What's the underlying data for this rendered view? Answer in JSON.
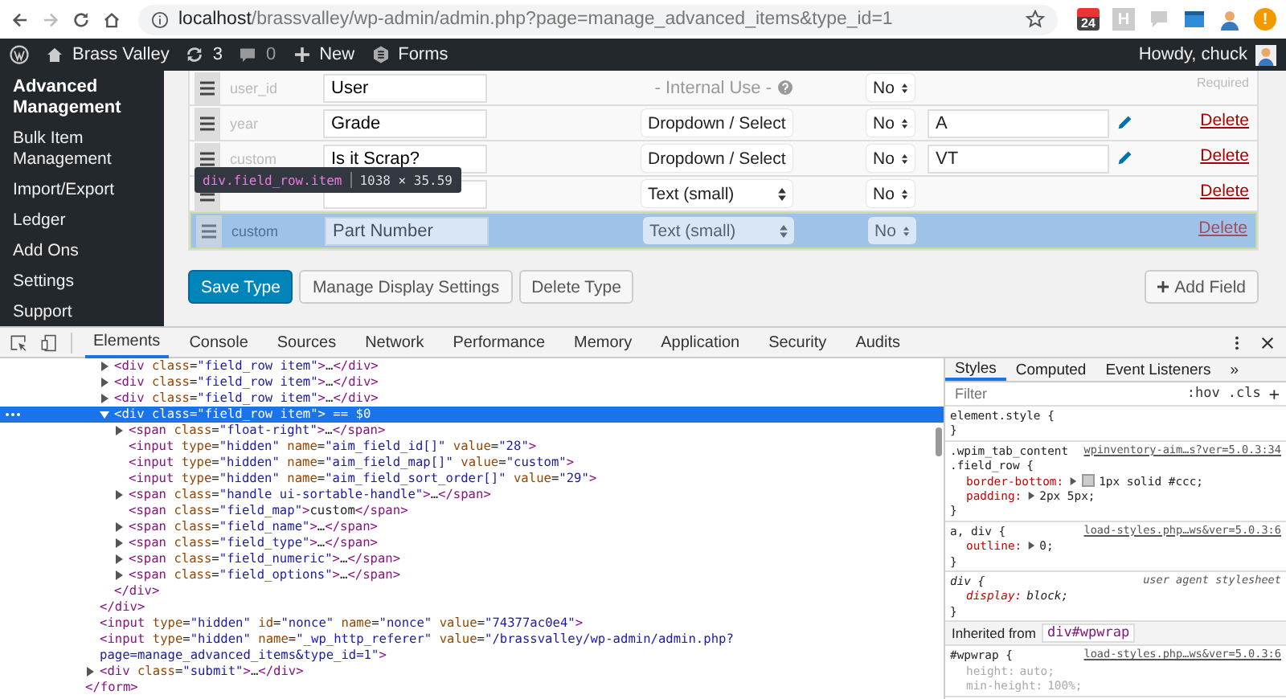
{
  "browser": {
    "url_host": "localhost",
    "url_path": "/brassvalley/wp-admin/admin.php?page=manage_advanced_items&type_id=1",
    "extensions": [
      {
        "kind": "calendar",
        "label": "24"
      },
      {
        "kind": "letter",
        "label": "H"
      },
      {
        "kind": "chat"
      },
      {
        "kind": "window"
      },
      {
        "kind": "avatar"
      },
      {
        "kind": "alert",
        "label": "!"
      }
    ]
  },
  "admin_bar": {
    "site": "Brass Valley",
    "updates": "3",
    "comments": "0",
    "new": "New",
    "forms": "Forms",
    "greeting": "Howdy, chuck"
  },
  "sidebar": {
    "items": [
      {
        "label": "Advanced Management",
        "selected": true
      },
      {
        "label": "Bulk Item Management",
        "selected": false
      },
      {
        "label": "Import/Export",
        "selected": false
      },
      {
        "label": "Ledger",
        "selected": false
      },
      {
        "label": "Add Ons",
        "selected": false
      },
      {
        "label": "Settings",
        "selected": false
      },
      {
        "label": "Support",
        "selected": false
      }
    ]
  },
  "fields": {
    "rows": [
      {
        "map": "user_id",
        "name": "User",
        "type": {
          "kind": "internal",
          "text": "- Internal Use -"
        },
        "numeric": "No",
        "note": "Required",
        "highlighted": false
      },
      {
        "map": "year",
        "name": "Grade",
        "type": {
          "kind": "select",
          "text": "Dropdown / Select"
        },
        "numeric": "No",
        "options": "A",
        "delete": "Delete",
        "highlighted": false
      },
      {
        "map": "custom",
        "name": "Is it Scrap?",
        "type": {
          "kind": "select",
          "text": "Dropdown / Select"
        },
        "numeric": "No",
        "options": "VT",
        "delete": "Delete",
        "highlighted": false
      },
      {
        "type": {
          "kind": "select",
          "text": "Text (small)"
        },
        "numeric": "No",
        "delete": "Delete",
        "highlighted": false,
        "tooltip": {
          "selector": "div.field_row.item",
          "size": "1038 × 35.59"
        }
      },
      {
        "map": "custom",
        "name": "Part Number",
        "type": {
          "kind": "select",
          "text": "Text (small)"
        },
        "numeric": "No",
        "delete": "Delete",
        "highlighted": true
      }
    ]
  },
  "buttons": [
    {
      "label": "Save Type",
      "kind": "primary"
    },
    {
      "label": "Manage Display Settings",
      "kind": "secondary"
    },
    {
      "label": "Delete Type",
      "kind": "secondary"
    }
  ],
  "add_field": "Add Field",
  "devtools": {
    "tabs": [
      {
        "label": "Elements",
        "selected": true
      },
      {
        "label": "Console",
        "selected": false
      },
      {
        "label": "Sources",
        "selected": false
      },
      {
        "label": "Network",
        "selected": false
      },
      {
        "label": "Performance",
        "selected": false
      },
      {
        "label": "Memory",
        "selected": false
      },
      {
        "label": "Application",
        "selected": false
      },
      {
        "label": "Security",
        "selected": false
      },
      {
        "label": "Audits",
        "selected": false
      }
    ],
    "dom": [
      {
        "close": "</form>",
        "children": [
          {
            "close": "</div>",
            "children": [
              {
                "markup": "<div class=\"field_row item\">…</div>",
                "expanded": false,
                "selected": false
              },
              {
                "markup": "<div class=\"field_row item\">…</div>",
                "expanded": false,
                "selected": false
              },
              {
                "markup": "<div class=\"field_row item\">…</div>",
                "expanded": false,
                "selected": false
              },
              {
                "markup": "<div class=\"field_row item\"> == $0",
                "expanded": true,
                "selected": true,
                "close": "</div>",
                "children": [
                  {
                    "markup": "<span class=\"float-right\">…</span>",
                    "expanded": false,
                    "selected": false
                  },
                  {
                    "markup": "<input type=\"hidden\" name=\"aim_field_id[]\" value=\"28\">",
                    "selected": false
                  },
                  {
                    "markup": "<input type=\"hidden\" name=\"aim_field_map[]\" value=\"custom\">",
                    "selected": false
                  },
                  {
                    "markup": "<input type=\"hidden\" name=\"aim_field_sort_order[]\" value=\"29\">",
                    "selected": false
                  },
                  {
                    "markup": "<span class=\"handle ui-sortable-handle\">…</span>",
                    "expanded": false,
                    "selected": false
                  },
                  {
                    "markup": "<span class=\"field_map\">custom</span>",
                    "selected": false
                  },
                  {
                    "markup": "<span class=\"field_name\">…</span>",
                    "expanded": false,
                    "selected": false
                  },
                  {
                    "markup": "<span class=\"field_type\">…</span>",
                    "expanded": false,
                    "selected": false
                  },
                  {
                    "markup": "<span class=\"field_numeric\">…</span>",
                    "expanded": false,
                    "selected": false
                  },
                  {
                    "markup": "<span class=\"field_options\">…</span>",
                    "expanded": false,
                    "selected": false
                  }
                ]
              }
            ]
          },
          {
            "markup": "<input type=\"hidden\" id=\"nonce\" name=\"nonce\" value=\"74377ac0e4\">",
            "selected": false
          },
          {
            "markup": "<input type=\"hidden\" name=\"_wp_http_referer\" value=\"/brassvalley/wp-admin/admin.php?page=manage_advanced_items&type_id=1\">",
            "selected": false
          },
          {
            "markup": "<div class=\"submit\">…</div>",
            "expanded": false,
            "selected": false
          }
        ]
      }
    ],
    "styles": {
      "tabs": [
        {
          "label": "Styles",
          "selected": true
        },
        {
          "label": "Computed",
          "selected": false
        },
        {
          "label": "Event Listeners",
          "selected": false
        }
      ],
      "more": "»",
      "filter_placeholder": "Filter",
      "hov": ":hov",
      "cls": ".cls",
      "add": "+",
      "sections": [
        {
          "kind": "rule",
          "selectors": [
            "element.style {"
          ],
          "close": "}",
          "italic": false
        },
        {
          "kind": "rule",
          "selectors": [
            ".wpim_tab_content",
            ".field_row {"
          ],
          "source": {
            "kind": "link",
            "text": "wpinventory-aim…s?ver=5.0.3:34"
          },
          "close": "}",
          "italic": false,
          "declarations": [
            {
              "property": "border-bottom:",
              "value": "1px solid #ccc;",
              "expandable": true,
              "color": "#cccccc",
              "dimmed": false
            },
            {
              "property": "padding:",
              "value": "2px 5px;",
              "expandable": true,
              "dimmed": false
            }
          ]
        },
        {
          "kind": "rule",
          "selectors": [
            "a, div {"
          ],
          "source": {
            "kind": "link",
            "text": "load-styles.php…ws&ver=5.0.3:6"
          },
          "close": "}",
          "italic": false,
          "declarations": [
            {
              "property": "outline:",
              "value": "0;",
              "expandable": true,
              "dimmed": false
            }
          ]
        },
        {
          "kind": "rule",
          "selectors": [
            "div {"
          ],
          "source": {
            "kind": "agent",
            "text": "user agent stylesheet"
          },
          "close": "}",
          "italic": true,
          "declarations": [
            {
              "property": "display:",
              "value": "block;",
              "expandable": false,
              "dimmed": false
            }
          ]
        },
        {
          "kind": "inherited",
          "label": "Inherited from",
          "element": "div#wpwrap"
        },
        {
          "kind": "rule",
          "selectors": [
            "#wpwrap {"
          ],
          "source": {
            "kind": "link",
            "text": "load-styles.php…ws&ver=5.0.3:6"
          },
          "italic": false,
          "declarations": [
            {
              "property": "height:",
              "value": "auto;",
              "expandable": false,
              "dimmed": true
            },
            {
              "property": "min-height:",
              "value": "100%;",
              "expandable": false,
              "dimmed": true
            }
          ]
        }
      ]
    }
  }
}
